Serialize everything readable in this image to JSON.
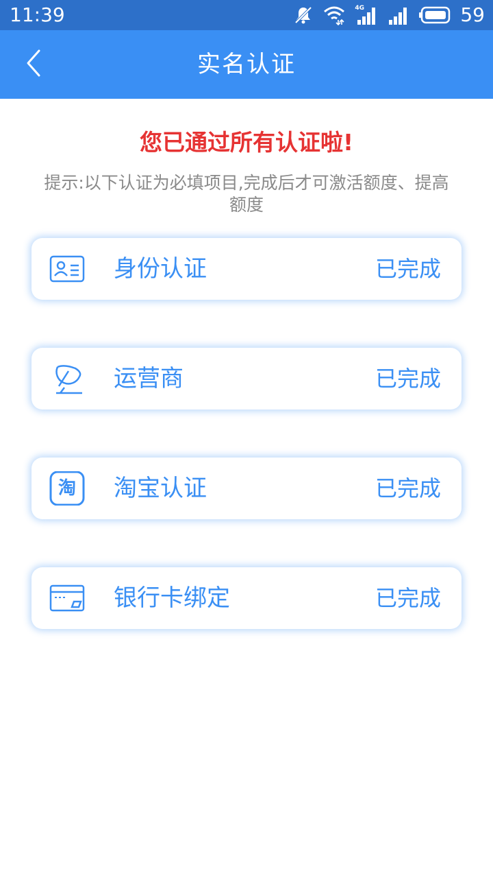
{
  "status_bar": {
    "time": "11:39",
    "network_label": "4G",
    "battery_level": "59",
    "icons": [
      "mute-icon",
      "wifi-icon",
      "signal-icon",
      "signal-icon",
      "battery-icon"
    ]
  },
  "header": {
    "title": "实名认证",
    "back_icon": "chevron-left-icon"
  },
  "main": {
    "success_message": "您已通过所有认证啦!",
    "hint": "提示:以下认证为必填项目,完成后才可激活额度、提高额度",
    "items": [
      {
        "label": "身份认证",
        "status": "已完成",
        "icon": "id-card-icon"
      },
      {
        "label": "运营商",
        "status": "已完成",
        "icon": "satellite-dish-icon"
      },
      {
        "label": "淘宝认证",
        "status": "已完成",
        "icon": "taobao-icon",
        "icon_text": "淘"
      },
      {
        "label": "银行卡绑定",
        "status": "已完成",
        "icon": "bank-card-icon"
      }
    ]
  },
  "colors": {
    "status_bar": "#2d70c9",
    "header": "#3a8ff4",
    "accent": "#3a8ff4",
    "success": "#e63333",
    "hint": "#8a8a8a"
  }
}
